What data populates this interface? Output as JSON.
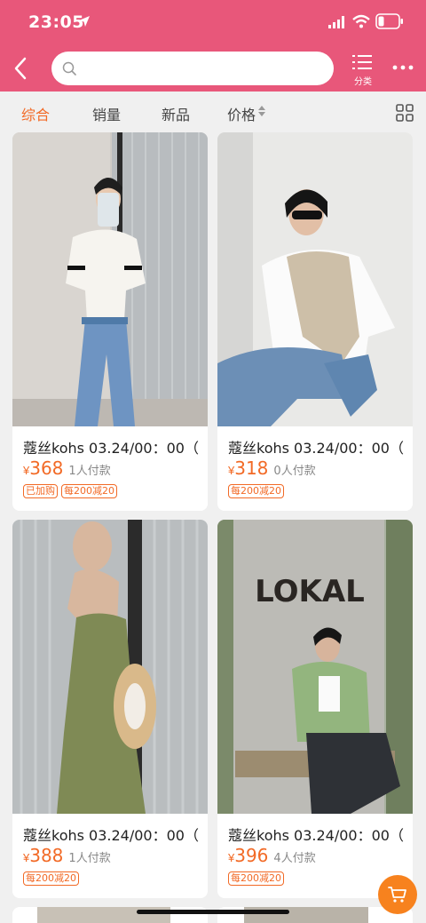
{
  "status": {
    "time": "23:05"
  },
  "search": {
    "placeholder": "",
    "value": ""
  },
  "nav": {
    "category_label": "分类"
  },
  "sort_tabs": [
    {
      "label": "综合",
      "active": true
    },
    {
      "label": "销量",
      "active": false
    },
    {
      "label": "新品",
      "active": false
    },
    {
      "label": "价格",
      "active": false
    }
  ],
  "products": [
    {
      "title": "蔻丝kohs 03.24/00：00（",
      "currency": "¥",
      "price": "368",
      "pay_count": "1人付款",
      "tags": [
        "已加购",
        "每200减20"
      ]
    },
    {
      "title": "蔻丝kohs 03.24/00：00（",
      "currency": "¥",
      "price": "318",
      "pay_count": "0人付款",
      "tags": [
        "每200减20"
      ]
    },
    {
      "title": "蔻丝kohs 03.24/00：00（",
      "currency": "¥",
      "price": "388",
      "pay_count": "1人付款",
      "tags": [
        "每200减20"
      ]
    },
    {
      "title": "蔻丝kohs 03.24/00：00（",
      "currency": "¥",
      "price": "396",
      "pay_count": "4人付款",
      "tags": [
        "每200减20"
      ]
    }
  ],
  "sign_text": "LOKAL",
  "colors": {
    "brand": "#e8577a",
    "accent": "#f26a26",
    "cart": "#f7821e"
  }
}
